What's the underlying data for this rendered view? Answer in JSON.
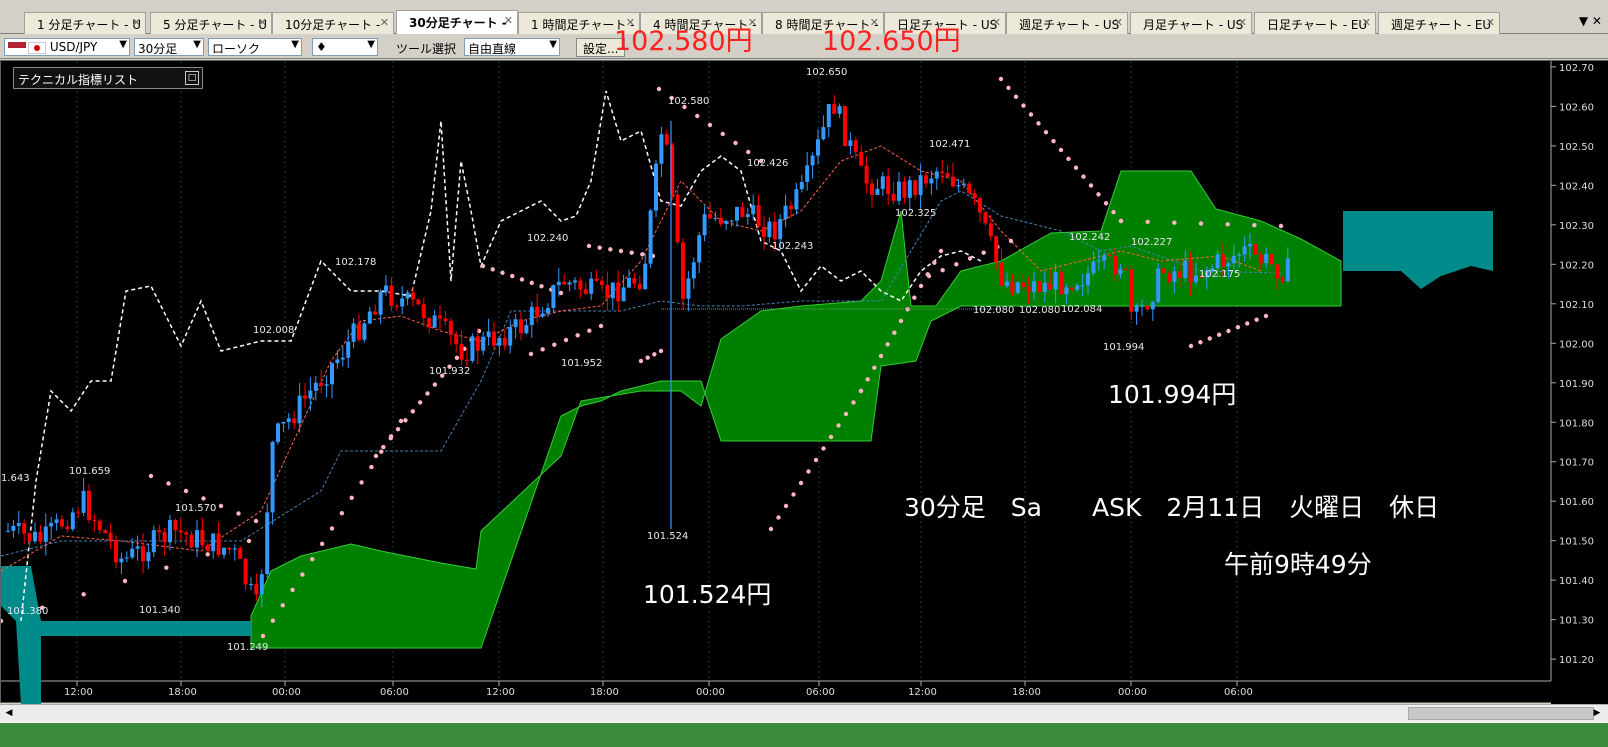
{
  "tabs": [
    {
      "label": "1 分足チャート - U",
      "active": false
    },
    {
      "label": "5 分足チャート - U",
      "active": false
    },
    {
      "label": "10分足チャート - ",
      "active": false
    },
    {
      "label": "30分足チャート - ",
      "active": true
    },
    {
      "label": "1 時間足チャート - ",
      "active": false
    },
    {
      "label": "4 時間足チャート - ",
      "active": false
    },
    {
      "label": "8 時間足チャート - ",
      "active": false
    },
    {
      "label": "日足チャート - US",
      "active": false
    },
    {
      "label": "週足チャート - US",
      "active": false
    },
    {
      "label": "月足チャート - US",
      "active": false
    },
    {
      "label": "日足チャート - EU",
      "active": false
    },
    {
      "label": "週足チャート - EU",
      "active": false
    }
  ],
  "toolbar": {
    "pair": "USD/JPY",
    "timeframe": "30分足",
    "chart_type": "ローソク",
    "draw_icon": "♦",
    "tool_label": "ツール選択",
    "tool_value": "自由直線",
    "settings_label": "設定..."
  },
  "indicator_list_label": "テクニカル指標リスト",
  "overlay_text": {
    "high1": "102.580円",
    "high2": "102.650円",
    "low_recent": "101.994円",
    "low_main": "101.524円",
    "info_line": "30分足　Sa　　ASK　2月11日　火曜日　休日",
    "time_line": "午前9時49分"
  },
  "colors": {
    "bull": "#3399ff",
    "bear": "#ff0000",
    "cloud_green": "#008000",
    "cloud_teal": "#008b8b",
    "chikou": "#ffffff",
    "psar": "#ffb6c1",
    "tenkan": "#ff6347",
    "kijun": "#4682b4",
    "overlay_red": "#ff2020"
  },
  "chart_data": {
    "type": "line",
    "title": "",
    "ylim": [
      101.17,
      102.72
    ],
    "y_ticks": [
      "102.70",
      "102.60",
      "102.50",
      "102.40",
      "102.30",
      "102.20",
      "102.10",
      "102.00",
      "101.90",
      "101.80",
      "101.70",
      "101.60",
      "101.50",
      "101.40",
      "101.30",
      "101.20"
    ],
    "x_ticks": [
      "12:00",
      "18:00",
      "00:00",
      "06:00",
      "12:00",
      "18:00",
      "00:00",
      "06:00",
      "12:00",
      "18:00",
      "00:00",
      "06:00"
    ],
    "price_labels": [
      "1.643",
      "101.659",
      "101.570",
      "101.380",
      "101.340",
      "101.249",
      "102.008",
      "102.178",
      "101.932",
      "102.240",
      "101.952",
      "102.580",
      "101.524",
      "102.426",
      "102.243",
      "102.650",
      "102.471",
      "102.325",
      "102.080",
      "102.080",
      "102.084",
      "102.242",
      "102.227",
      "101.994",
      "102.175"
    ]
  }
}
